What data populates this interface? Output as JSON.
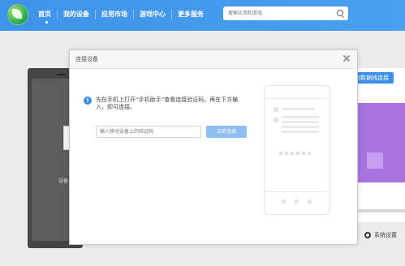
{
  "app": {
    "nav": [
      "首页",
      "我的设备",
      "应用市场",
      "游戏中心",
      "更多服务"
    ],
    "search_placeholder": "搜索应用和游戏"
  },
  "background": {
    "device_label": "设备",
    "wireless_button": "扫数据线连接",
    "settings_label": "系统设置"
  },
  "dialog": {
    "title": "连接设备",
    "instruction": "先在手机上打开“手机助手”查看连接验证码，再在下方输入，即可连接。",
    "input_placeholder": "输入移动设备上的验证码",
    "connect_button": "立即连接"
  }
}
